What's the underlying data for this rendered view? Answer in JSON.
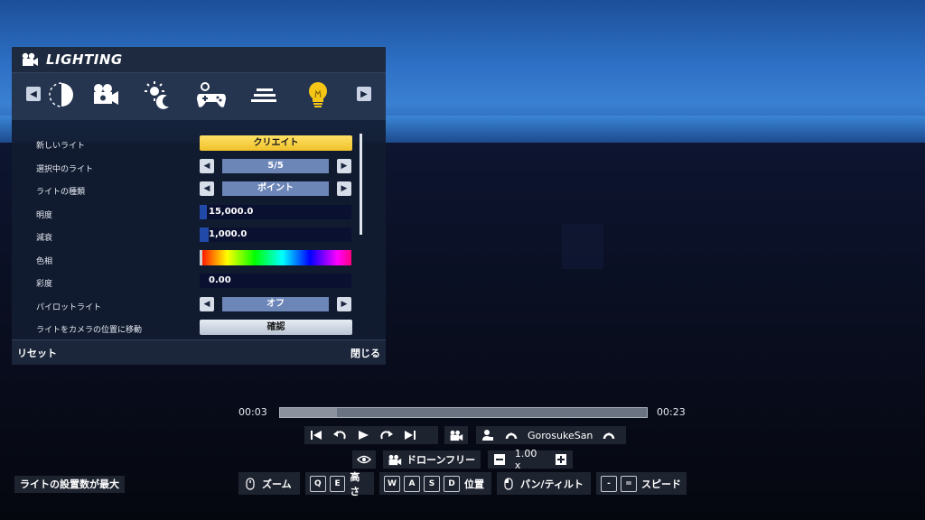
{
  "panel": {
    "title": "LIGHTING",
    "tabs": [
      "tab-time",
      "tab-camera",
      "tab-weather",
      "tab-controller",
      "tab-filter",
      "tab-lighting"
    ],
    "rows": {
      "new_light": {
        "label": "新しいライト",
        "button": "クリエイト"
      },
      "selected_light": {
        "label": "選択中のライト",
        "value": "5/5"
      },
      "light_type": {
        "label": "ライトの種類",
        "value": "ポイント"
      },
      "brightness": {
        "label": "明度",
        "value": "15,000.0"
      },
      "attenuation": {
        "label": "減衰",
        "value": "1,000.0"
      },
      "hue": {
        "label": "色相"
      },
      "saturation": {
        "label": "彩度",
        "value": "0.00"
      },
      "pilot_light": {
        "label": "パイロットライト",
        "value": "オフ"
      },
      "move_to_camera": {
        "label": "ライトをカメラの位置に移動",
        "button": "確認"
      }
    },
    "footer": {
      "reset": "リセット",
      "close": "閉じる"
    }
  },
  "timeline": {
    "current": "00:03",
    "total": "00:23",
    "progress": 0.155
  },
  "playback": {
    "player_name": "GorosukeSan"
  },
  "camera": {
    "mode": "ドローンフリー",
    "speed": "1.00 x"
  },
  "controls": {
    "zoom": "ズーム",
    "height_keys": [
      "Q",
      "E"
    ],
    "height": "高さ",
    "move_keys": [
      "W",
      "A",
      "S",
      "D"
    ],
    "position": "位置",
    "pan_tilt": "パン/ティルト",
    "speed_keys": [
      "-",
      "="
    ],
    "speed": "スピード"
  },
  "status": "ライトの設置数が最大",
  "colors": {
    "accent_yellow": "#f0c22a",
    "slider_fill": "#2149a8",
    "stepper": "#6c86b8"
  }
}
